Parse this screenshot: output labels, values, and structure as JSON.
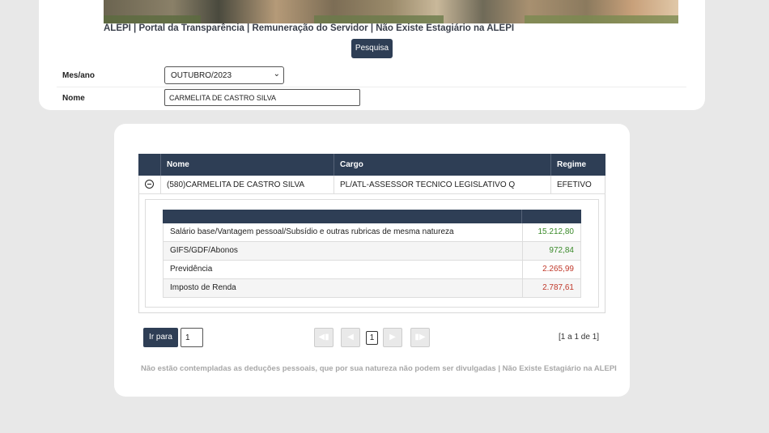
{
  "header": {
    "site_title": "ALEPI | Portal da Transparência | Remuneração do Servidor | Não Existe Estagiário na ALEPI",
    "search_button": "Pesquisa"
  },
  "filters": {
    "month_label": "Mes/ano",
    "month_value": "OUTUBRO/2023",
    "name_label": "Nome",
    "name_value": "CARMELITA DE CASTRO SILVA"
  },
  "table": {
    "columns": [
      "Nome",
      "Cargo",
      "Regime"
    ],
    "row": {
      "nome": "(580)CARMELITA DE CASTRO SILVA",
      "cargo": "PL/ATL-ASSESSOR TECNICO LEGISLATIVO Q",
      "regime": "EFETIVO"
    }
  },
  "details": [
    {
      "label": "Salário base/Vantagem pessoal/Subsídio e outras rubricas de mesma natureza",
      "value": "15.212,80",
      "color": "#3a8a2a"
    },
    {
      "label": "GIFS/GDF/Abonos",
      "value": "972,84",
      "color": "#3a8a2a"
    },
    {
      "label": "Previdência",
      "value": "2.265,99",
      "color": "#c0392b"
    },
    {
      "label": "Imposto de Renda",
      "value": "2.787,61",
      "color": "#c0392b"
    }
  ],
  "pagination": {
    "goto_label": "Ir para",
    "goto_value": "1",
    "current_page": "1",
    "info": "[1 a 1 de 1]"
  },
  "footnote": "Não estão contempladas as deduções pessoais, que por sua natureza não podem ser divulgadas | Não Existe Estagiário na ALEPI",
  "icons": [
    "collapse-row-icon",
    "first-page-icon",
    "prev-page-icon",
    "next-page-icon",
    "last-page-icon",
    "chevron-down-icon"
  ]
}
